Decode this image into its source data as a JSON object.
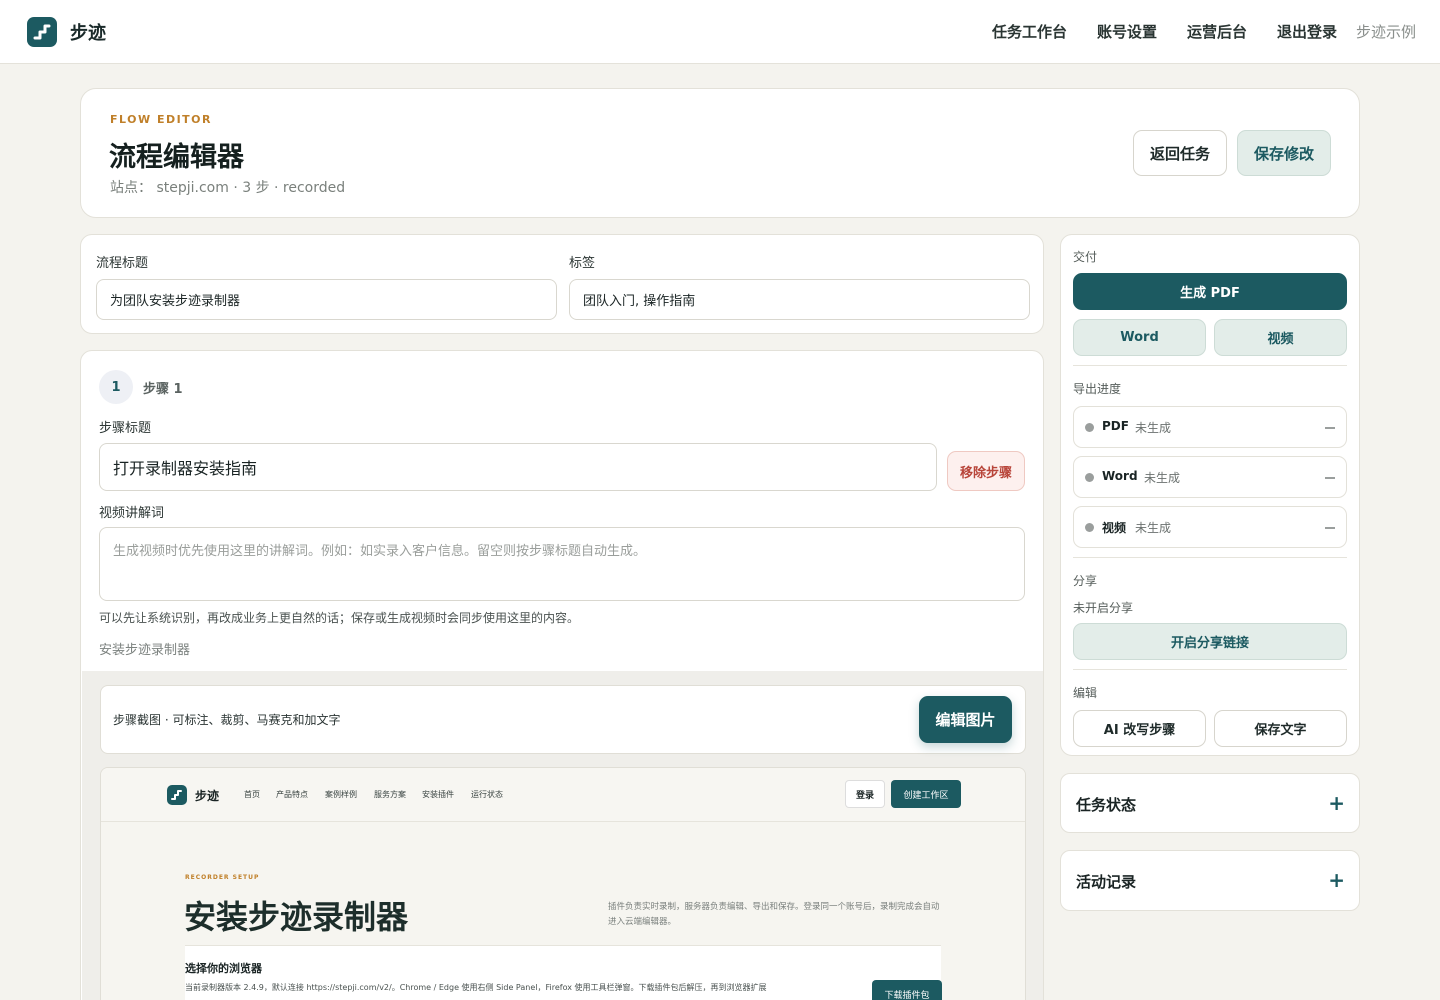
{
  "topbar": {
    "brand": "步迹",
    "nav": [
      "任务工作台",
      "账号设置",
      "运营后台",
      "退出登录"
    ],
    "example": "步迹示例"
  },
  "header": {
    "eyebrow": "FLOW EDITOR",
    "title": "流程编辑器",
    "subtitle": "站点： stepji.com · 3 步 · recorded",
    "back_button": "返回任务",
    "save_button": "保存修改"
  },
  "meta": {
    "flow_title_label": "流程标题",
    "flow_title_value": "为团队安装步迹录制器",
    "tags_label": "标签",
    "tags_value": "团队入门, 操作指南"
  },
  "step": {
    "number": "1",
    "label": "步骤 1",
    "title_label": "步骤标题",
    "title_value": "打开录制器安装指南",
    "remove_button": "移除步骤",
    "narration_label": "视频讲解词",
    "narration_placeholder": "生成视频时优先使用这里的讲解词。例如：如实录入客户信息。留空则按步骤标题自动生成。",
    "narration_hint": "可以先让系统识别，再改成业务上更自然的话；保存或生成视频时会同步使用这里的内容。",
    "caption": "安装步迹录制器",
    "shot_toolbar_text": "步骤截图 · 可标注、裁剪、马赛克和加文字",
    "edit_image_button": "编辑图片"
  },
  "preview": {
    "brand": "步迹",
    "nav": [
      "首页",
      "产品特点",
      "案例样例",
      "服务方案",
      "安装插件",
      "运行状态"
    ],
    "login": "登录",
    "create": "创建工作区",
    "eyebrow": "RECORDER SETUP",
    "title": "安装步迹录制器",
    "desc": "插件负责实时录制，服务器负责编辑、导出和保存。登录同一个账号后，录制完成会自动进入云端编辑器。",
    "browser_title": "选择你的浏览器",
    "browser_desc": "当前录制器版本 2.4.9，默认连接 https://stepji.com/v2/。Chrome / Edge 使用右侧 Side Panel，Firefox 使用工具栏弹窗。下载插件包后解压，再到浏览器扩展",
    "download": "下载插件包"
  },
  "delivery": {
    "label": "交付",
    "pdf_button": "生成 PDF",
    "word_button": "Word",
    "video_button": "视频"
  },
  "progress": {
    "label": "导出进度",
    "items": [
      {
        "name": "PDF",
        "status": "未生成"
      },
      {
        "name": "Word",
        "status": "未生成"
      },
      {
        "name": "视频",
        "status": "未生成"
      }
    ]
  },
  "share": {
    "label": "分享",
    "status": "未开启分享",
    "button": "开启分享链接"
  },
  "edit": {
    "label": "编辑",
    "ai_button": "AI 改写步骤",
    "save_text_button": "保存文字"
  },
  "panels": {
    "task_status": "任务状态",
    "activity": "活动记录"
  }
}
